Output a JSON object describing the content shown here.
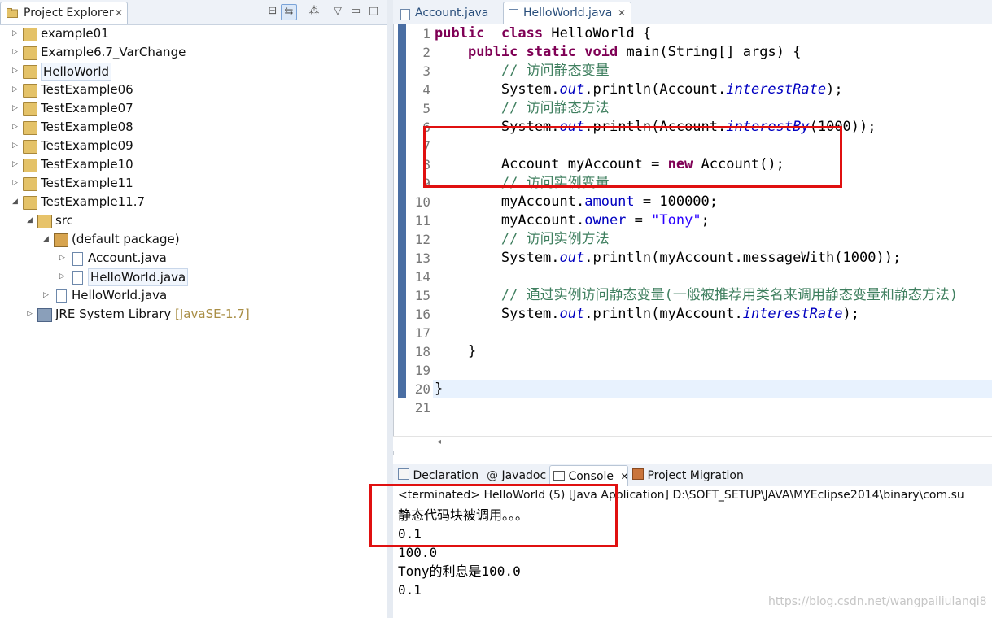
{
  "project_explorer": {
    "tab_label": "Project Explorer",
    "close_glyph": "✕",
    "tools": [
      "collapse-all-icon",
      "link-editor-icon",
      "filter-icon",
      "view-menu-icon",
      "minimize-icon"
    ],
    "items": [
      {
        "label": "example01",
        "level": 0,
        "arrow": "▷",
        "icon": "project"
      },
      {
        "label": "Example6.7_VarChange",
        "level": 0,
        "arrow": "▷",
        "icon": "project"
      },
      {
        "label": "HelloWorld",
        "level": 0,
        "arrow": "▷",
        "icon": "project",
        "boxed": true
      },
      {
        "label": "TestExample06",
        "level": 0,
        "arrow": "▷",
        "icon": "project"
      },
      {
        "label": "TestExample07",
        "level": 0,
        "arrow": "▷",
        "icon": "project"
      },
      {
        "label": "TestExample08",
        "level": 0,
        "arrow": "▷",
        "icon": "project"
      },
      {
        "label": "TestExample09",
        "level": 0,
        "arrow": "▷",
        "icon": "project"
      },
      {
        "label": "TestExample10",
        "level": 0,
        "arrow": "▷",
        "icon": "project"
      },
      {
        "label": "TestExample11",
        "level": 0,
        "arrow": "▷",
        "icon": "project"
      },
      {
        "label": "TestExample11.7",
        "level": 0,
        "arrow": "◢",
        "icon": "project"
      },
      {
        "label": "src",
        "level": 1,
        "arrow": "◢",
        "icon": "src"
      },
      {
        "label": "(default package)",
        "level": 2,
        "arrow": "◢",
        "icon": "package"
      },
      {
        "label": "Account.java",
        "level": 3,
        "arrow": "▷",
        "icon": "file"
      },
      {
        "label": "HelloWorld.java",
        "level": 3,
        "arrow": "▷",
        "icon": "file",
        "boxed": true
      },
      {
        "label": "HelloWorld.java",
        "level": 2,
        "arrow": "▷",
        "icon": "file"
      },
      {
        "label": "JRE System Library",
        "level": 1,
        "arrow": "▷",
        "icon": "library",
        "decoration": "[JavaSE-1.7]"
      }
    ]
  },
  "editor": {
    "tabs": [
      {
        "label": "Account.java",
        "active": false
      },
      {
        "label": "HelloWorld.java",
        "active": true,
        "close": "✕"
      }
    ],
    "line_numbers": [
      "1",
      "2",
      "3",
      "4",
      "5",
      "6",
      "7",
      "8",
      "9",
      "10",
      "11",
      "12",
      "13",
      "14",
      "15",
      "16",
      "17",
      "18",
      "19",
      "20",
      "21"
    ],
    "code": [
      [
        [
          "kw",
          "public"
        ],
        [
          "",
          "  "
        ],
        [
          "kw",
          "class"
        ],
        [
          "",
          " HelloWorld {"
        ]
      ],
      [
        [
          "",
          "    "
        ],
        [
          "kw",
          "public"
        ],
        [
          "",
          " "
        ],
        [
          "kw",
          "static"
        ],
        [
          "",
          " "
        ],
        [
          "kw",
          "void"
        ],
        [
          "",
          " main(String[] args) {"
        ]
      ],
      [
        [
          "",
          "        "
        ],
        [
          "cm",
          "// 访问静态变量"
        ]
      ],
      [
        [
          "",
          "        System."
        ],
        [
          "fld",
          "out"
        ],
        [
          "",
          ".println(Account."
        ],
        [
          "fld",
          "interestRate"
        ],
        [
          "",
          ");"
        ]
      ],
      [
        [
          "",
          "        "
        ],
        [
          "cm",
          "// 访问静态方法"
        ]
      ],
      [
        [
          "",
          "        System."
        ],
        [
          "fld",
          "out"
        ],
        [
          "",
          ".println(Account."
        ],
        [
          "fld",
          "interestBy"
        ],
        [
          "",
          "(1000));"
        ]
      ],
      [
        [
          "",
          ""
        ]
      ],
      [
        [
          "",
          "        Account myAccount = "
        ],
        [
          "kw",
          "new"
        ],
        [
          "",
          " Account();"
        ]
      ],
      [
        [
          "",
          "        "
        ],
        [
          "cm",
          "// 访问实例变量"
        ]
      ],
      [
        [
          "",
          "        myAccount."
        ],
        [
          "ifld",
          "amount"
        ],
        [
          "",
          " = 100000;"
        ]
      ],
      [
        [
          "",
          "        myAccount."
        ],
        [
          "ifld",
          "owner"
        ],
        [
          "",
          " = "
        ],
        [
          "str",
          "\"Tony\""
        ],
        [
          "",
          ";"
        ]
      ],
      [
        [
          "",
          "        "
        ],
        [
          "cm",
          "// 访问实例方法"
        ]
      ],
      [
        [
          "",
          "        System."
        ],
        [
          "fld",
          "out"
        ],
        [
          "",
          ".println(myAccount.messageWith(1000));"
        ]
      ],
      [
        [
          "",
          ""
        ]
      ],
      [
        [
          "",
          "        "
        ],
        [
          "cm",
          "// 通过实例访问静态变量(一般被推荐用类名来调用静态变量和静态方法)"
        ]
      ],
      [
        [
          "",
          "        System."
        ],
        [
          "fld",
          "out"
        ],
        [
          "",
          ".println(myAccount."
        ],
        [
          "fld",
          "interestRate"
        ],
        [
          "",
          ");"
        ]
      ],
      [
        [
          "",
          ""
        ]
      ],
      [
        [
          "",
          "    }"
        ]
      ],
      [
        [
          "",
          ""
        ]
      ],
      [
        [
          "",
          "}"
        ]
      ],
      [
        [
          "",
          ""
        ]
      ]
    ]
  },
  "bottom_tabs": [
    {
      "label": "Declaration",
      "icon": "declaration-icon"
    },
    {
      "label": "Javadoc",
      "icon": "javadoc-icon",
      "glyph": "@"
    },
    {
      "label": "Console",
      "icon": "console-icon",
      "active": true,
      "close": "✕"
    },
    {
      "label": "Project Migration",
      "icon": "migration-icon"
    }
  ],
  "console": {
    "header": "<terminated> HelloWorld (5) [Java Application] D:\\SOFT_SETUP\\JAVA\\MYEclipse2014\\binary\\com.su",
    "lines": [
      "静态代码块被调用。。。",
      "0.1",
      "100.0",
      "Tony的利息是100.0",
      "0.1"
    ]
  },
  "watermark": "https://blog.csdn.net/wangpailiulanqi8",
  "colors": {
    "keyword": "#7f0055",
    "comment": "#3f7f5f",
    "field": "#0000c0",
    "string": "#2a00ff",
    "highlight_box": "#e01010"
  }
}
